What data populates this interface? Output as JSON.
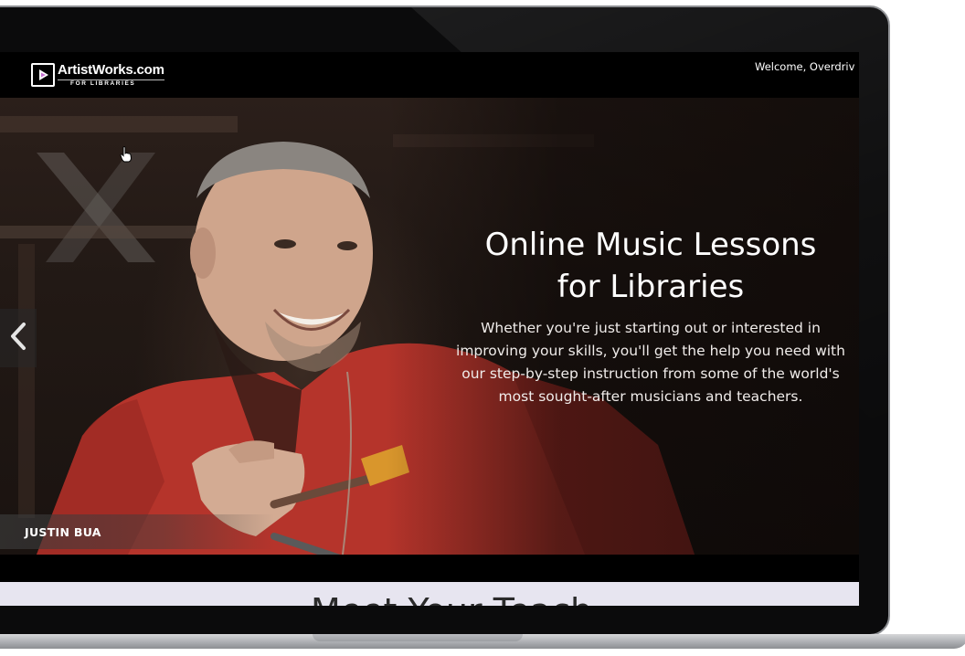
{
  "brand": {
    "name": "ArtistWorks.com",
    "sub": "FOR LIBRARIES"
  },
  "header": {
    "welcome": "Welcome, Overdriv"
  },
  "hero": {
    "title_line1": "Online Music Lessons",
    "title_line2": "for Libraries",
    "description": "Whether you're just starting out or interested in improving your skills, you'll get the help you need with our step-by-step instruction from some of the world's most sought-after musicians and teachers.",
    "caption": "JUSTIN BUA"
  },
  "section": {
    "heading": "Meet Your Teach"
  },
  "colors": {
    "screen_bg": "#000000",
    "below_band": "#e7e5f0",
    "shirt_red": "#b5342b"
  },
  "icons": {
    "logo": "play-icon",
    "prev": "chevron-left-icon",
    "cursor": "hand-pointer-icon"
  }
}
